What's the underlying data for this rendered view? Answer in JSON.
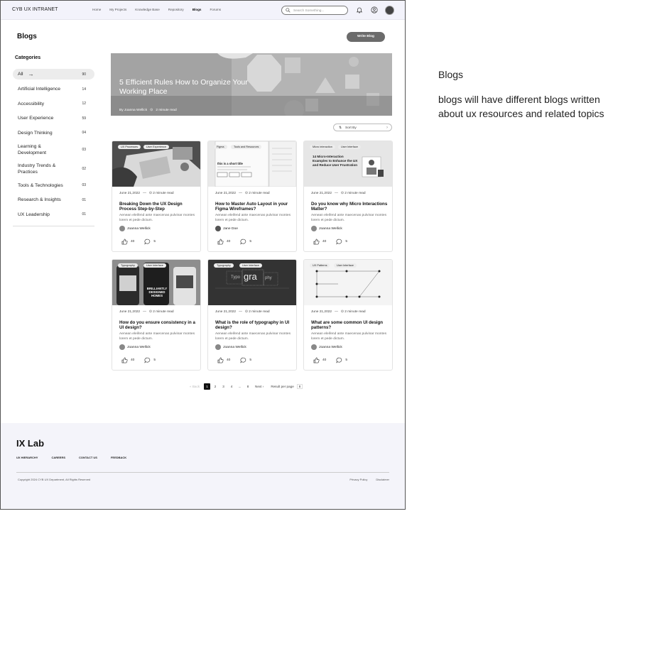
{
  "header": {
    "brand": "CYB UX INTRANET",
    "nav": [
      "Home",
      "My Projects",
      "Knowledge Base",
      "Repository",
      "Blogs",
      "Forums"
    ],
    "active_nav": "Blogs",
    "search_placeholder": "Search Something..."
  },
  "page": {
    "title": "Blogs",
    "write_button": "Write Blog"
  },
  "sidebar": {
    "title": "Categories",
    "items": [
      {
        "label": "All",
        "count": "90"
      },
      {
        "label": "Artificial Intelligence",
        "count": "14"
      },
      {
        "label": "Accessibility",
        "count": "12"
      },
      {
        "label": "User Experience",
        "count": "59"
      },
      {
        "label": "Design Thinking",
        "count": "04"
      },
      {
        "label": "Learning & Development",
        "count": "03"
      },
      {
        "label": "Industry Trends & Practices",
        "count": "02"
      },
      {
        "label": "Tools & Technologies",
        "count": "03"
      },
      {
        "label": "Research & Insights",
        "count": "01"
      },
      {
        "label": "UX Leadership",
        "count": "01"
      }
    ]
  },
  "hero": {
    "title": "5 Efficient Rules How to Organize Your Working Place",
    "author": "By Joanna Wellick",
    "read_time": "2 minute read"
  },
  "sort": {
    "label": "Sort By"
  },
  "cards": [
    {
      "tags": [
        "UX Processes",
        "User Experience"
      ],
      "date": "June 21,2022",
      "read_time": "2 minute read",
      "title": "Breaking Down the UX Design Process Step-by-Step",
      "excerpt": "Aenean eleifend ante maecenas pulvinar montes lorem et pede dictum.",
      "author": "Joanna Wellick",
      "likes": "40",
      "comments": "5"
    },
    {
      "tags": [
        "Figma",
        "Tools and Resources"
      ],
      "date": "June 21,2022",
      "read_time": "2 minute read",
      "title": "How to Master Auto Layout in your Figma Wireframes?",
      "excerpt": "Aenean eleifend ante maecenas pulvinar montes lorem et pede dictum.",
      "author": "Jane Doe",
      "likes": "40",
      "comments": "5"
    },
    {
      "tags": [
        "Micro interaction",
        "User Interface"
      ],
      "date": "June 21,2022",
      "read_time": "2 minute read",
      "title": "Do you know why Micro Interactions Matter?",
      "excerpt": "Aenean eleifend ante maecenas pulvinar montes lorem et pede dictum.",
      "author": "Joanna Wellick",
      "likes": "40",
      "comments": "5"
    },
    {
      "tags": [
        "Typography",
        "User Interface"
      ],
      "date": "June 21,2022",
      "read_time": "2 minute read",
      "title": "How do you ensure consistency in a UI design?",
      "excerpt": "Aenean eleifend ante maecenas pulvinar montes lorem et pede dictum.",
      "author": "Joanna Wellick",
      "likes": "40",
      "comments": "5"
    },
    {
      "tags": [
        "Typography",
        "User Interface"
      ],
      "date": "June 21,2022",
      "read_time": "2 minute read",
      "title": "What is the role of typography in UI design?",
      "excerpt": "Aenean eleifend ante maecenas pulvinar montes lorem et pede dictum.",
      "author": "Joanna Wellick",
      "likes": "40",
      "comments": "5"
    },
    {
      "tags": [
        "UX Patterns",
        "User Interface"
      ],
      "date": "June 21,2022",
      "read_time": "2 minute read",
      "title": "What are some common UI design patterns?",
      "excerpt": "Aenean eleifend ante maecenas pulvinar montes lorem et pede dictum.",
      "author": "Joanna Wellick",
      "likes": "40",
      "comments": "5"
    }
  ],
  "thumb_text": {
    "micro": "14 Micro-Interaction Examples to Enhance the UX and Reduce User Frustration",
    "figma_short": "this is a short title",
    "typo_a": "Typo",
    "typo_b": "gra",
    "typo_c": "phy",
    "brilliantly": "BRILLIANTLY DESIGNED HOMES"
  },
  "pagination": {
    "prev": "« Back",
    "pages": [
      "1",
      "2",
      "3",
      "4",
      "...",
      "8"
    ],
    "current": "1",
    "next": "Next ›",
    "per_page_label": "Result per page",
    "per_page_value": "8"
  },
  "footer": {
    "brand": "IX Lab",
    "links": [
      "UX HIERARCHY",
      "CAREERS",
      "CONTACT US",
      "FEEDBACK"
    ],
    "copyright": "Copyright 2024 CYB UX Department, All Rights Reserved",
    "legal": [
      "Privacy Policy",
      "Disclaimer"
    ]
  },
  "annotation": {
    "title": "Blogs",
    "text": "blogs will have different blogs written about ux resources and related topics"
  }
}
